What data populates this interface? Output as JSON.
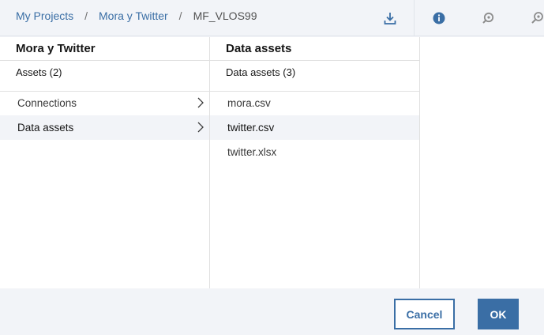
{
  "breadcrumb": {
    "items": [
      "My Projects",
      "Mora y Twitter"
    ],
    "separator": "/",
    "current": "MF_VLOS99"
  },
  "toolbar": {
    "icons": [
      "download-icon",
      "info-icon",
      "history-icon",
      "share-icon"
    ]
  },
  "left_panel": {
    "title": "Mora y Twitter",
    "subtitle": "Assets (2)",
    "items": [
      {
        "label": "Connections",
        "selected": false
      },
      {
        "label": "Data assets",
        "selected": true
      }
    ]
  },
  "mid_panel": {
    "title": "Data assets",
    "subtitle": "Data assets (3)",
    "items": [
      {
        "label": "mora.csv",
        "selected": false
      },
      {
        "label": "twitter.csv",
        "selected": true
      },
      {
        "label": "twitter.xlsx",
        "selected": false
      }
    ]
  },
  "footer": {
    "cancel_label": "Cancel",
    "ok_label": "OK"
  },
  "colors": {
    "accent": "#3a6ea5",
    "background": "#f2f4f8",
    "panel": "#ffffff"
  }
}
